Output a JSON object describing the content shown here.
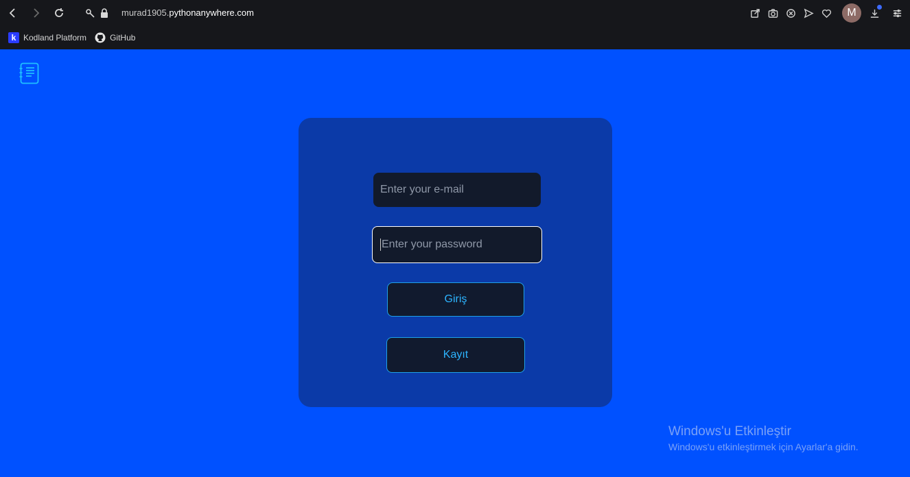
{
  "browser": {
    "url_prefix": "murad1905.",
    "url_host": "pythonanywhere.com",
    "avatar_letter": "M",
    "bookmarks": [
      {
        "label": "Kodland Platform",
        "icon": "kodland-icon"
      },
      {
        "label": "GitHub",
        "icon": "github-icon"
      }
    ]
  },
  "form": {
    "email_placeholder": "Enter your e-mail",
    "password_placeholder": "Enter your password",
    "login_label": "Giriş",
    "register_label": "Kayıt"
  },
  "watermark": {
    "title": "Windows'u Etkinleştir",
    "subtitle": "Windows'u etkinleştirmek için Ayarlar'a gidin."
  },
  "colors": {
    "page_background": "#0051ff",
    "card_background": "#0b3aa8",
    "input_background": "#121a2b",
    "button_accent": "#1fa2e8"
  }
}
